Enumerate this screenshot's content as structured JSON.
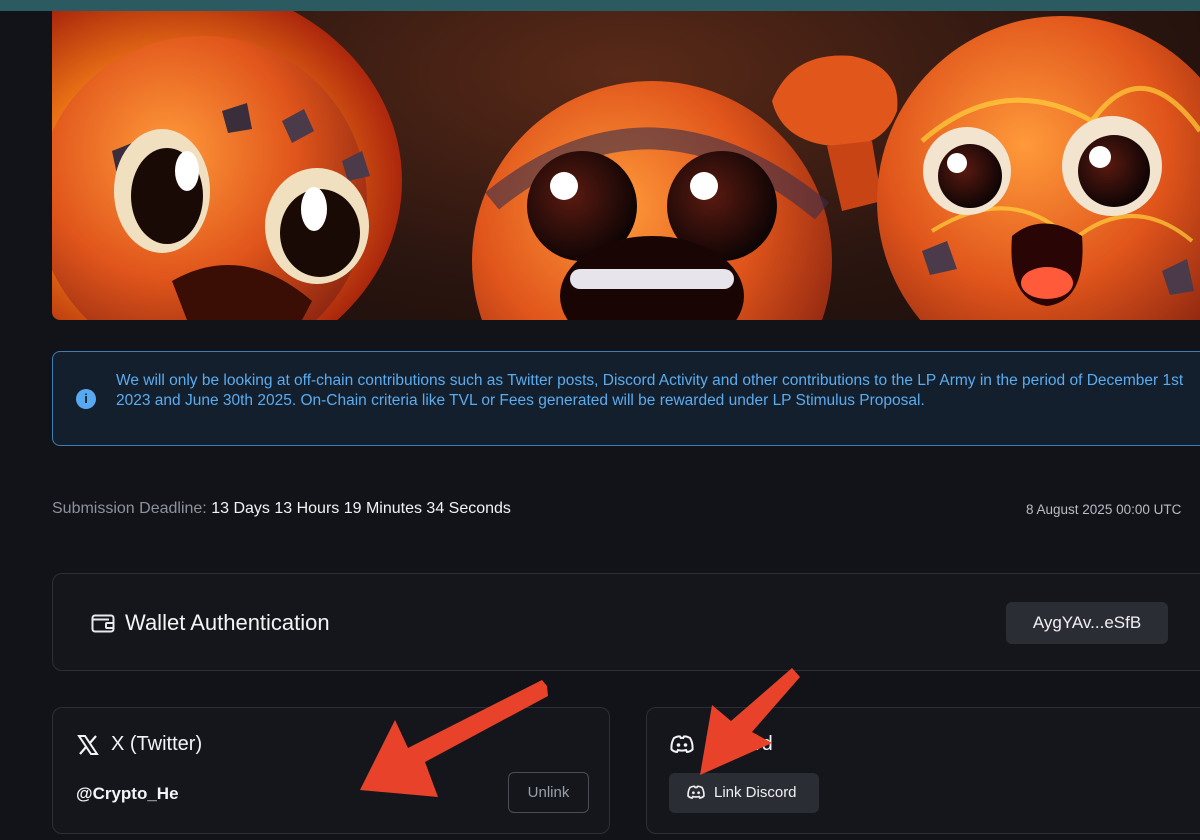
{
  "info_banner": {
    "icon": "info-icon",
    "text": "We will only be looking at off-chain contributions such as Twitter posts, Discord Activity and other contributions to the LP Army in the period of December 1st 2023 and June 30th 2025. On-Chain criteria like TVL or Fees generated will be rewarded under LP Stimulus Proposal."
  },
  "deadline": {
    "label": "Submission Deadline:",
    "countdown": "13 Days 13 Hours 19 Minutes 34 Seconds",
    "date": "8 August 2025 00:00 UTC"
  },
  "wallet": {
    "icon": "wallet-icon",
    "title": "Wallet Authentication",
    "address": "AygYAv...eSfB"
  },
  "twitter": {
    "icon": "x-logo-icon",
    "title": "X (Twitter)",
    "handle": "@Crypto_He",
    "unlink_label": "Unlink"
  },
  "discord": {
    "icon": "discord-icon",
    "title": "Discord",
    "link_label": "Link Discord"
  },
  "colors": {
    "background": "#111318",
    "info_text": "#5aacf1",
    "info_border": "#3c7fb4",
    "annotation_arrow": "#e8432a"
  }
}
